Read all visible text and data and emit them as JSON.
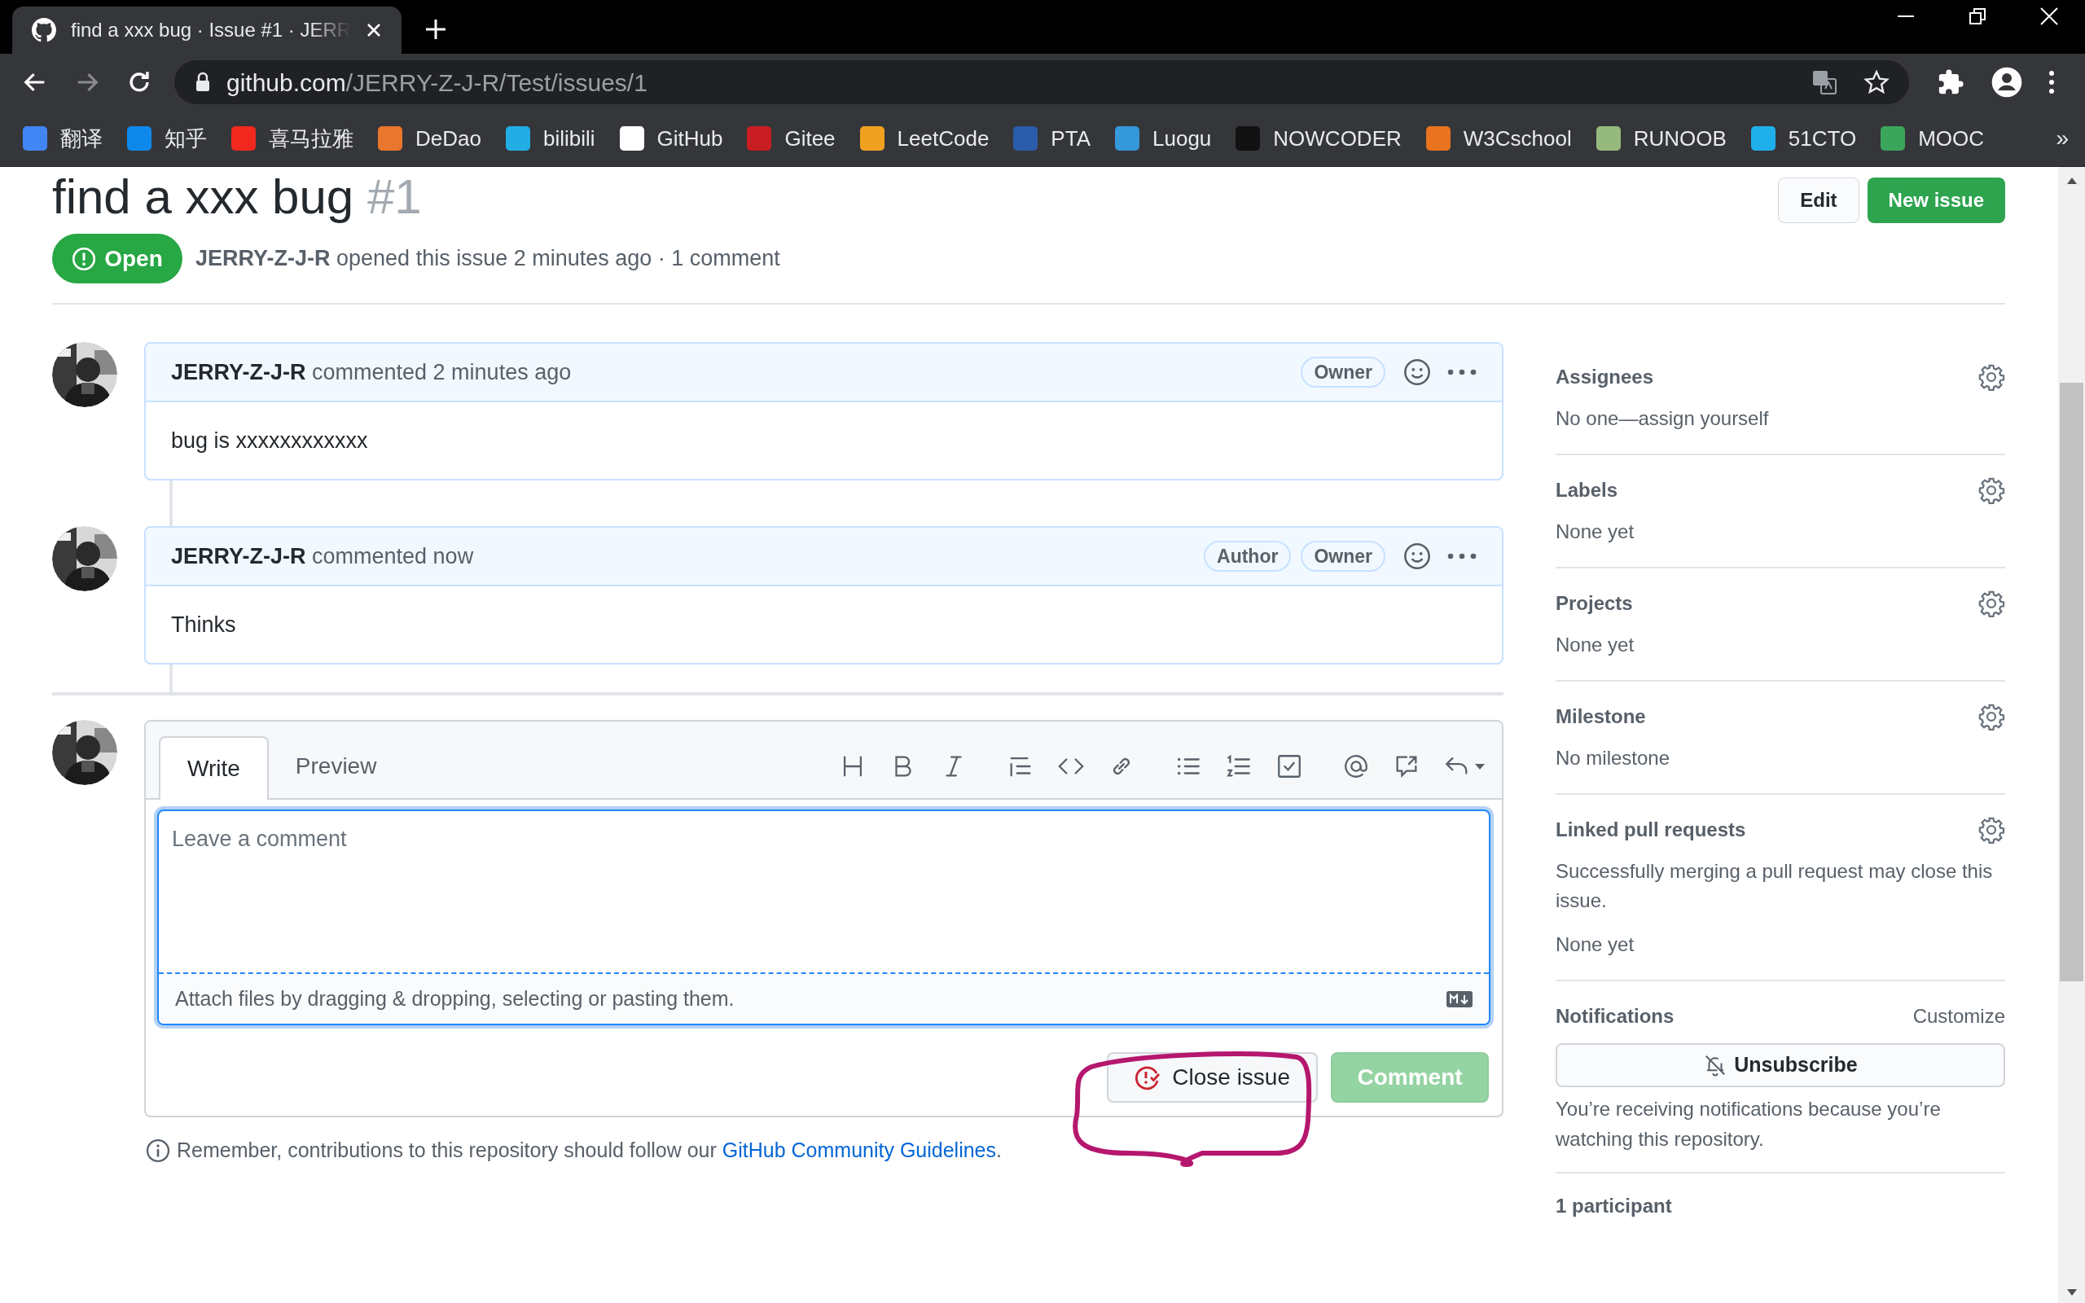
{
  "browser": {
    "tab": {
      "title": "find a xxx bug · Issue #1 · JERR"
    },
    "url": {
      "host": "github.com",
      "path": "/JERRY-Z-J-R/Test/issues/1"
    },
    "bookmarks": [
      {
        "label": "翻译",
        "color": "#4285f4"
      },
      {
        "label": "知乎",
        "color": "#0f88eb"
      },
      {
        "label": "喜马拉雅",
        "color": "#f0281e"
      },
      {
        "label": "DeDao",
        "color": "#e8762c"
      },
      {
        "label": "bilibili",
        "color": "#23ade5"
      },
      {
        "label": "GitHub",
        "color": "#ffffff"
      },
      {
        "label": "Gitee",
        "color": "#c71d23"
      },
      {
        "label": "LeetCode",
        "color": "#f0a11f"
      },
      {
        "label": "PTA",
        "color": "#2a5caa"
      },
      {
        "label": "Luogu",
        "color": "#3498db"
      },
      {
        "label": "NOWCODER",
        "color": "#111111"
      },
      {
        "label": "W3Cschool",
        "color": "#e9731f"
      },
      {
        "label": "RUNOOB",
        "color": "#96b97d"
      },
      {
        "label": "51CTO",
        "color": "#1fb0ec"
      },
      {
        "label": "MOOC",
        "color": "#3ca55c"
      }
    ],
    "more": "»"
  },
  "issue": {
    "title": "find a xxx bug",
    "number": "#1",
    "buttons": [
      "Edit",
      "New issue"
    ],
    "state": "Open",
    "author": "JERRY-Z-J-R",
    "meta": "opened this issue 2 minutes ago · 1 comment"
  },
  "comments": [
    {
      "author": "JERRY-Z-J-R",
      "action": "commented 2 minutes ago",
      "badges": [
        "Owner"
      ],
      "body": "bug is xxxxxxxxxxxx"
    },
    {
      "author": "JERRY-Z-J-R",
      "action": "commented now",
      "badges": [
        "Author",
        "Owner"
      ],
      "body": "Thinks"
    }
  ],
  "editor": {
    "tabs": [
      {
        "label": "Write",
        "selected": true
      },
      {
        "label": "Preview",
        "selected": false
      }
    ],
    "placeholder": "Leave a comment",
    "attach": "Attach files by dragging & dropping, selecting or pasting them.",
    "close_button": "Close issue",
    "comment_button": {
      "label": "Comment",
      "disabled": true
    }
  },
  "note": {
    "text": "Remember, contributions to this repository should follow our",
    "link": "GitHub Community Guidelines",
    "end": "."
  },
  "sidebar": {
    "sections": [
      {
        "title": "Assignees",
        "texts": [
          "No one—assign yourself"
        ]
      },
      {
        "title": "Labels",
        "texts": [
          "None yet"
        ]
      },
      {
        "title": "Projects",
        "texts": [
          "None yet"
        ]
      },
      {
        "title": "Milestone",
        "texts": [
          "No milestone"
        ]
      },
      {
        "title": "Linked pull requests",
        "texts": [
          "Successfully merging a pull request may close this issue.",
          "None yet"
        ]
      }
    ],
    "notifications": {
      "title": "Notifications",
      "customize": "Customize",
      "button": "Unsubscribe",
      "text": "You’re receiving notifications because you’re watching this repository."
    },
    "participants": "1 participant"
  }
}
